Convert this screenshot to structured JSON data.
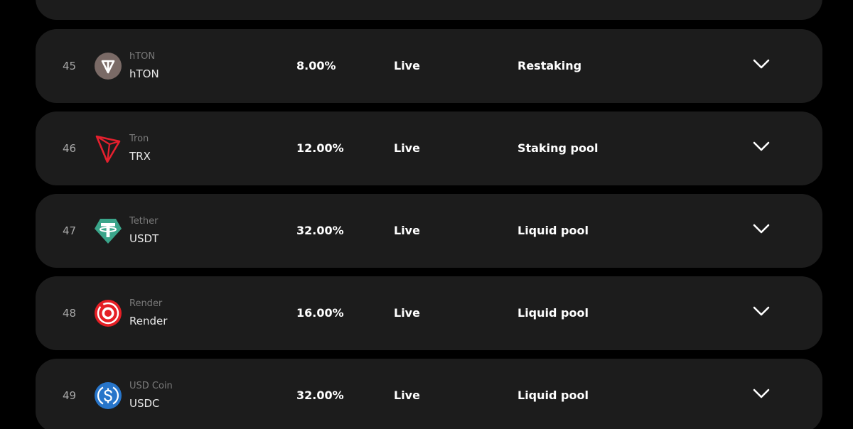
{
  "colors": {
    "background": "#000000",
    "row_background": "#1c1c1c",
    "text_primary": "#ffffff",
    "text_muted": "#7a7a7a",
    "rank_text": "#a8a8a8",
    "hton_logo": "#7a6a66",
    "tron_logo": "#e5202e",
    "tether_logo": "#3aa58a",
    "render_logo": "#e51f25",
    "usdc_logo": "#2775ca"
  },
  "rows": [
    {
      "rank": "45",
      "logo_icon": "hton-icon",
      "name": "hTON",
      "symbol": "hTON",
      "apy": "8.00%",
      "status": "Live",
      "type": "Restaking"
    },
    {
      "rank": "46",
      "logo_icon": "tron-icon",
      "name": "Tron",
      "symbol": "TRX",
      "apy": "12.00%",
      "status": "Live",
      "type": "Staking pool"
    },
    {
      "rank": "47",
      "logo_icon": "tether-icon",
      "name": "Tether",
      "symbol": "USDT",
      "apy": "32.00%",
      "status": "Live",
      "type": "Liquid pool"
    },
    {
      "rank": "48",
      "logo_icon": "render-icon",
      "name": "Render",
      "symbol": "Render",
      "apy": "16.00%",
      "status": "Live",
      "type": "Liquid pool"
    },
    {
      "rank": "49",
      "logo_icon": "usdc-icon",
      "name": "USD Coin",
      "symbol": "USDC",
      "apy": "32.00%",
      "status": "Live",
      "type": "Liquid pool"
    }
  ],
  "expand_icon": "chevron-down-icon"
}
